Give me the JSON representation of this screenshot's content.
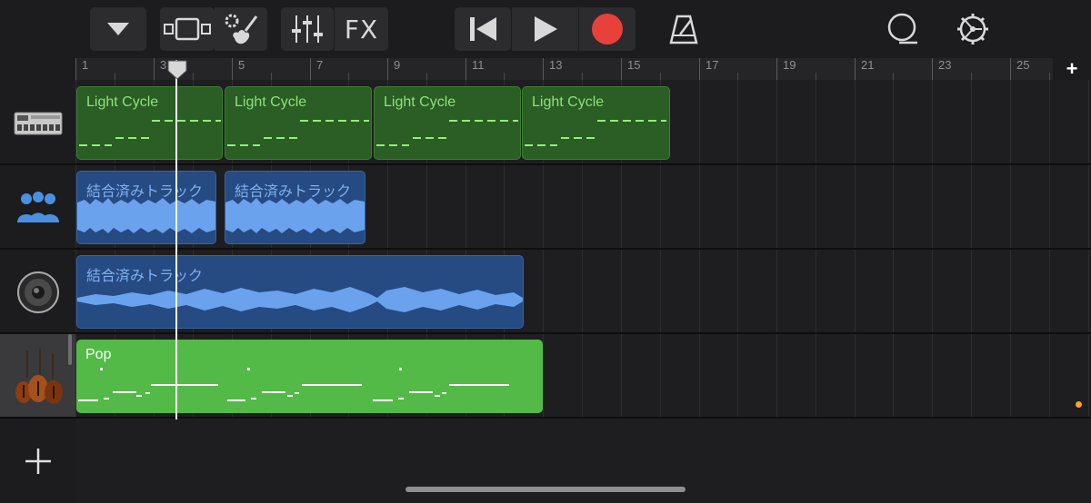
{
  "toolbar": {
    "fx_label": "FX",
    "buttons": [
      "tracks-menu-icon",
      "track-view-icon",
      "instrument-icon",
      "mixer-icon",
      "fx-button",
      "rewind-icon",
      "play-icon",
      "record-icon",
      "metronome-icon",
      "loop-icon",
      "settings-icon"
    ],
    "record_color": "#e8413b"
  },
  "ruler": {
    "bar_labels": [
      "1",
      "3",
      "5",
      "7",
      "9",
      "11",
      "13",
      "15",
      "17",
      "19",
      "21",
      "23",
      "25"
    ],
    "add_section_label": "+"
  },
  "tracks": [
    {
      "instrument": "drum-machine-icon",
      "selected": false
    },
    {
      "instrument": "drummer-group-icon",
      "selected": false
    },
    {
      "instrument": "speaker-icon",
      "selected": false
    },
    {
      "instrument": "strings-icon",
      "selected": true
    }
  ],
  "regions": {
    "track1": [
      "Light Cycle",
      "Light Cycle",
      "Light Cycle",
      "Light Cycle"
    ],
    "track2": [
      "結合済みトラック",
      "結合済みトラック"
    ],
    "track3": [
      "結合済みトラック"
    ],
    "track4": [
      "Pop"
    ]
  },
  "add_track_label": "+",
  "colors": {
    "background": "#1c1c1e",
    "midi_region": "#2a5e24",
    "audio_region": "#264a82",
    "live_loop_region": "#53b947",
    "playhead": "#f5f5f5"
  }
}
